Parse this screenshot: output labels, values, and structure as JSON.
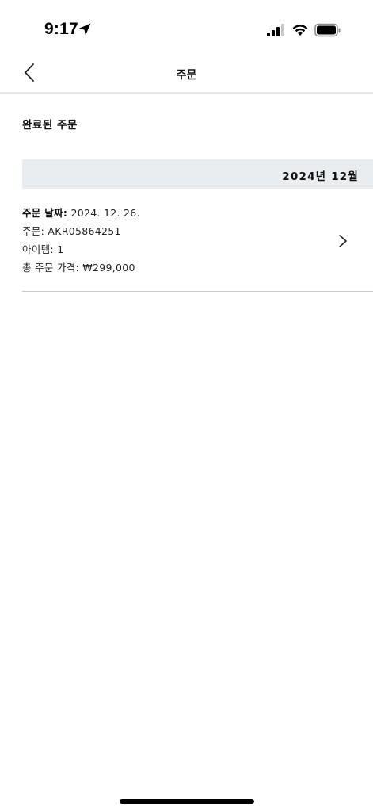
{
  "status_bar": {
    "time": "9:17"
  },
  "nav": {
    "title": "주문"
  },
  "section": {
    "title": "완료된 주문"
  },
  "month_group": {
    "label": "2024년 12월"
  },
  "order": {
    "date_label": "주문 날짜:",
    "date_value": "2024. 12. 26.",
    "number_label": "주문:",
    "number_value": "AKR05864251",
    "items_label": "아이템:",
    "items_value": "1",
    "total_label": "총 주문 가격:",
    "total_value": "₩299,000"
  },
  "icons": {
    "back": "chevron-left-icon",
    "order_detail": "chevron-right-icon",
    "location": "location-arrow-icon",
    "signal": "cellular-signal-icon",
    "wifi": "wifi-icon",
    "battery": "battery-icon"
  },
  "colors": {
    "month_header_bg": "#eaedf0",
    "divider": "#c8c8c8",
    "text": "#111111"
  }
}
